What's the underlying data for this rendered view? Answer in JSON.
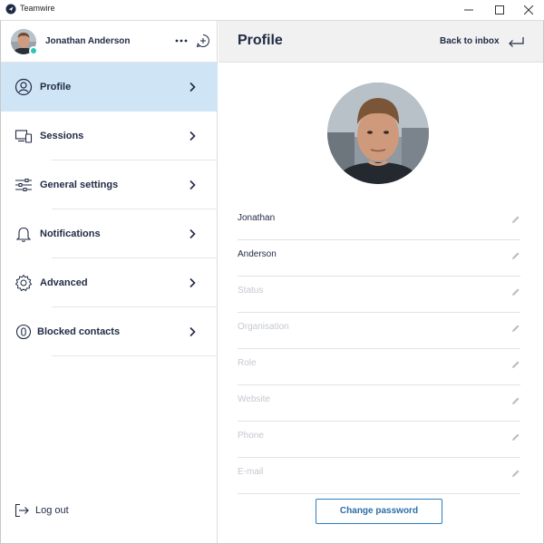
{
  "window": {
    "title": "Teamwire",
    "controls": [
      "minimize",
      "maximize",
      "close"
    ]
  },
  "sidebar": {
    "user_name": "Jonathan Anderson",
    "status_color": "#2ec4b6",
    "items": [
      {
        "label": "Profile",
        "icon": "user-icon",
        "active": true
      },
      {
        "label": "Sessions",
        "icon": "devices-icon",
        "active": false
      },
      {
        "label": "General settings",
        "icon": "sliders-icon",
        "active": false
      },
      {
        "label": "Notifications",
        "icon": "bell-icon",
        "active": false
      },
      {
        "label": "Advanced",
        "icon": "gear-icon",
        "active": false
      },
      {
        "label": "Blocked contacts",
        "icon": "blocked-icon",
        "active": false
      }
    ],
    "logout_label": "Log out"
  },
  "main": {
    "title": "Profile",
    "back_label": "Back to inbox",
    "fields": [
      {
        "value": "Jonathan",
        "placeholder": false
      },
      {
        "value": "Anderson",
        "placeholder": false
      },
      {
        "value": "Status",
        "placeholder": true
      },
      {
        "value": "Organisation",
        "placeholder": true
      },
      {
        "value": "Role",
        "placeholder": true
      },
      {
        "value": "Website",
        "placeholder": true
      },
      {
        "value": "Phone",
        "placeholder": true
      },
      {
        "value": "E-mail",
        "placeholder": true
      }
    ],
    "change_password_label": "Change password"
  },
  "colors": {
    "active_item_bg": "#cfe4f4",
    "accent": "#2d7fc1",
    "text_dark": "#1f2a44"
  }
}
